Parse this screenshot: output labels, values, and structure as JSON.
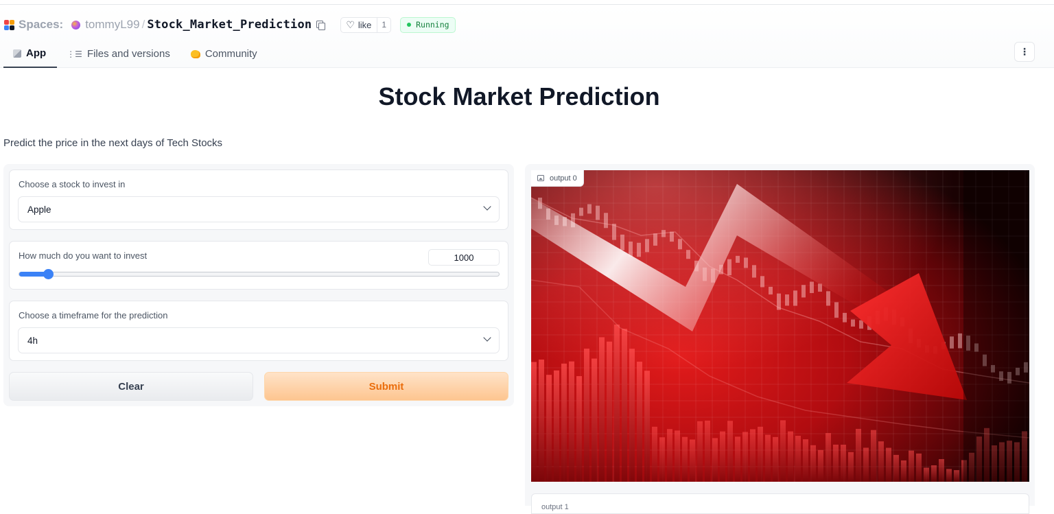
{
  "header": {
    "spaces_label": "Spaces:",
    "owner": "tommyL99",
    "separator": "/",
    "repo": "Stock_Market_Prediction",
    "like_label": "like",
    "like_count": "1",
    "status": "Running",
    "colors": {
      "status_green": "#22c55e",
      "accent_blue": "#3b82f6",
      "submit_orange": "#ea6d0c"
    }
  },
  "tabs": [
    {
      "label": "App",
      "icon": "app-icon",
      "active": true
    },
    {
      "label": "Files and versions",
      "icon": "files-icon",
      "active": false
    },
    {
      "label": "Community",
      "icon": "community-icon",
      "active": false
    }
  ],
  "main": {
    "title": "Stock Market Prediction",
    "description": "Predict the price in the next days of Tech Stocks"
  },
  "inputs": {
    "stock": {
      "label": "Choose a stock to invest in",
      "value": "Apple"
    },
    "invest": {
      "label": "How much do you want to invest",
      "value": "1000",
      "fraction": 0.06
    },
    "timeframe": {
      "label": "Choose a timeframe for the prediction",
      "value": "4h"
    },
    "clear_label": "Clear",
    "submit_label": "Submit"
  },
  "outputs": {
    "image_label": "output 0",
    "second_label": "output 1"
  }
}
